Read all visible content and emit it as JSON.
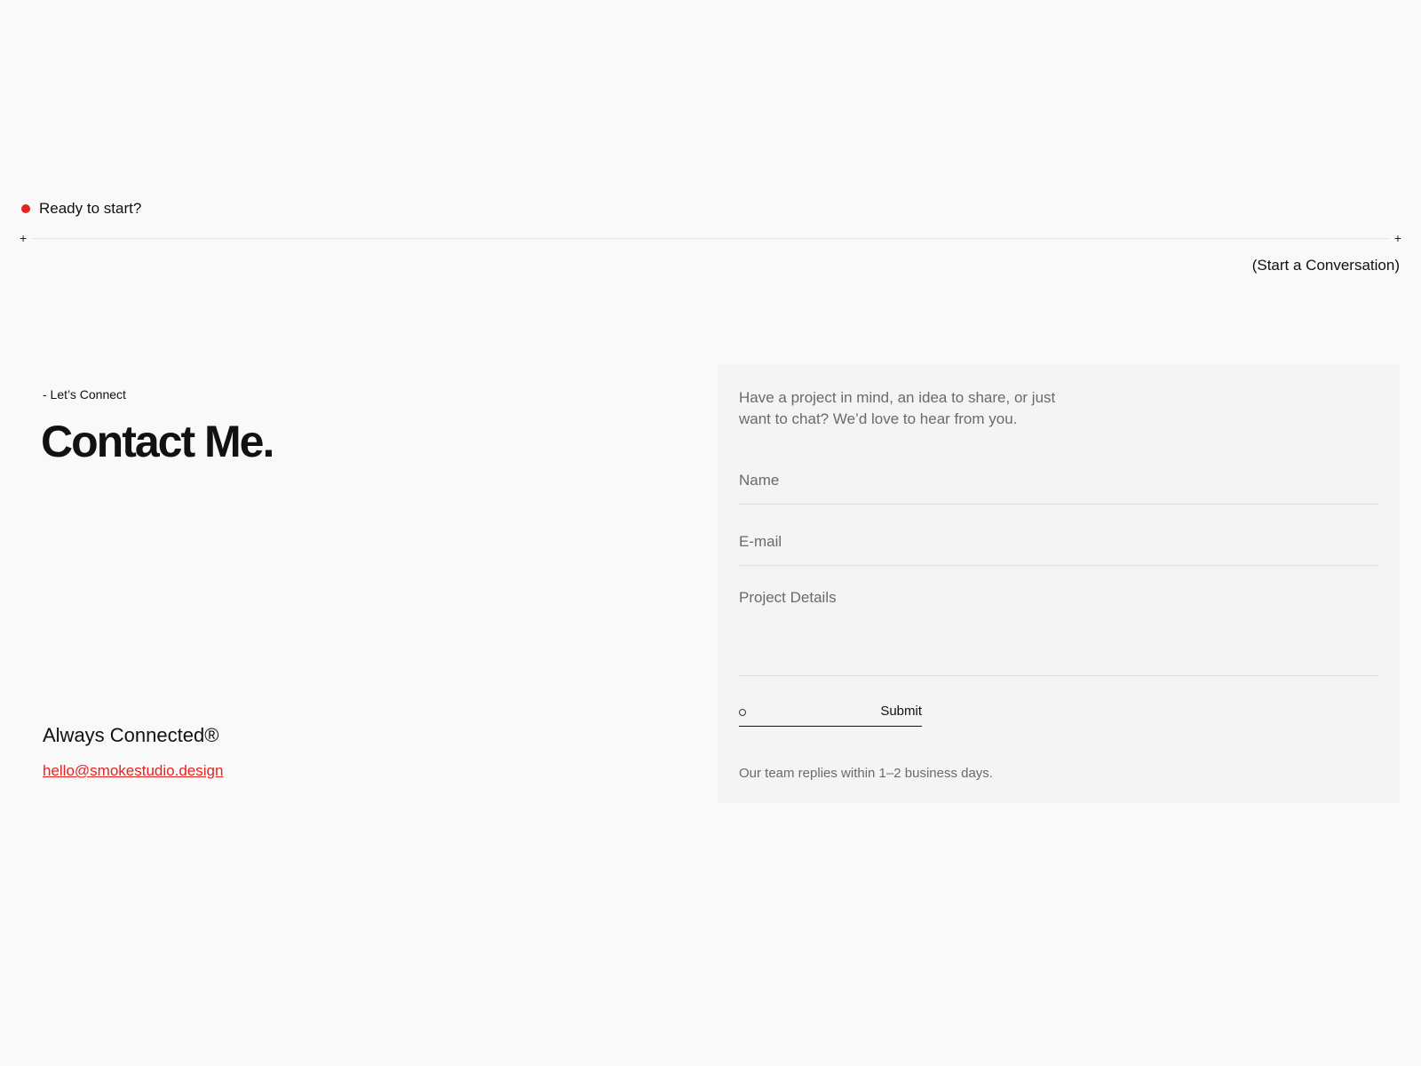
{
  "header": {
    "eyebrow": "Ready to start?",
    "cta": "(Start a Conversation)"
  },
  "intro": {
    "kicker": "- Let’s Connect",
    "headline": "Contact Me."
  },
  "contact": {
    "tagline": "Always Connected®",
    "email": "hello@smokestudio.design"
  },
  "form": {
    "intro_text": "Have a project in mind, an idea to share, or just want to chat? We’d love to hear from you.",
    "name_placeholder": "Name",
    "email_placeholder": "E-mail",
    "details_placeholder": "Project Details",
    "submit_label": "Submit",
    "note": "Our team replies within 1–2 business days."
  },
  "colors": {
    "accent": "#e4231f",
    "background": "#f9f9f9",
    "panel": "#f4f4f4"
  }
}
